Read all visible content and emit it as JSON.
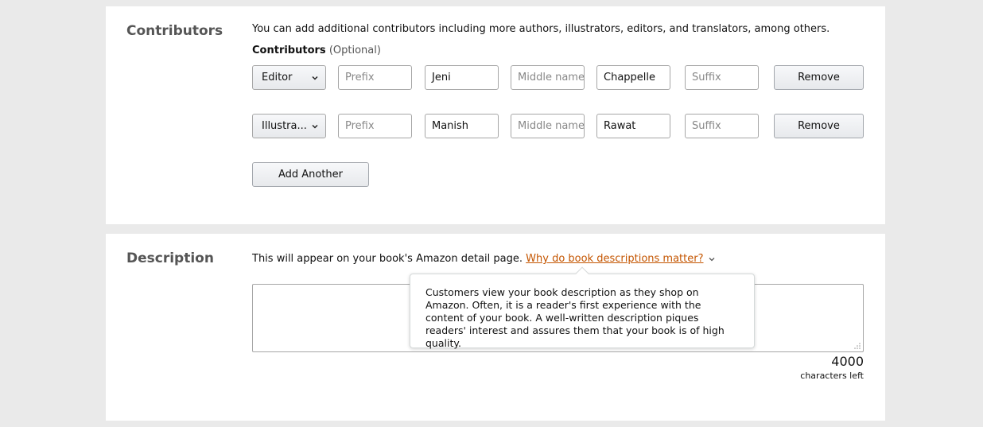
{
  "contributors": {
    "title": "Contributors",
    "intro": "You can add additional contributors including more authors, illustrators, editors, and translators, among others.",
    "label": "Contributors",
    "optional": "(Optional)",
    "rows": [
      {
        "role": "Editor",
        "prefix_placeholder": "Prefix",
        "first": "Jeni",
        "middle_placeholder": "Middle name",
        "last": "Chappelle",
        "suffix_placeholder": "Suffix",
        "remove_label": "Remove"
      },
      {
        "role": "Illustra...",
        "prefix_placeholder": "Prefix",
        "first": "Manish",
        "middle_placeholder": "Middle name",
        "last": "Rawat",
        "suffix_placeholder": "Suffix",
        "remove_label": "Remove"
      }
    ],
    "add_label": "Add Another"
  },
  "description": {
    "title": "Description",
    "intro": "This will appear on your book's Amazon detail page.",
    "link": "Why do book descriptions matter?",
    "chars_left": "4000",
    "chars_left_label": "characters left",
    "tooltip": "Customers view your book description as they shop on Amazon. Often, it is a reader's first experience with the content of your book. A well-written description piques readers' interest and assures them that your book is of high quality."
  },
  "colors": {
    "link": "#c45500",
    "background": "#eaeaea",
    "panel": "#ffffff"
  }
}
